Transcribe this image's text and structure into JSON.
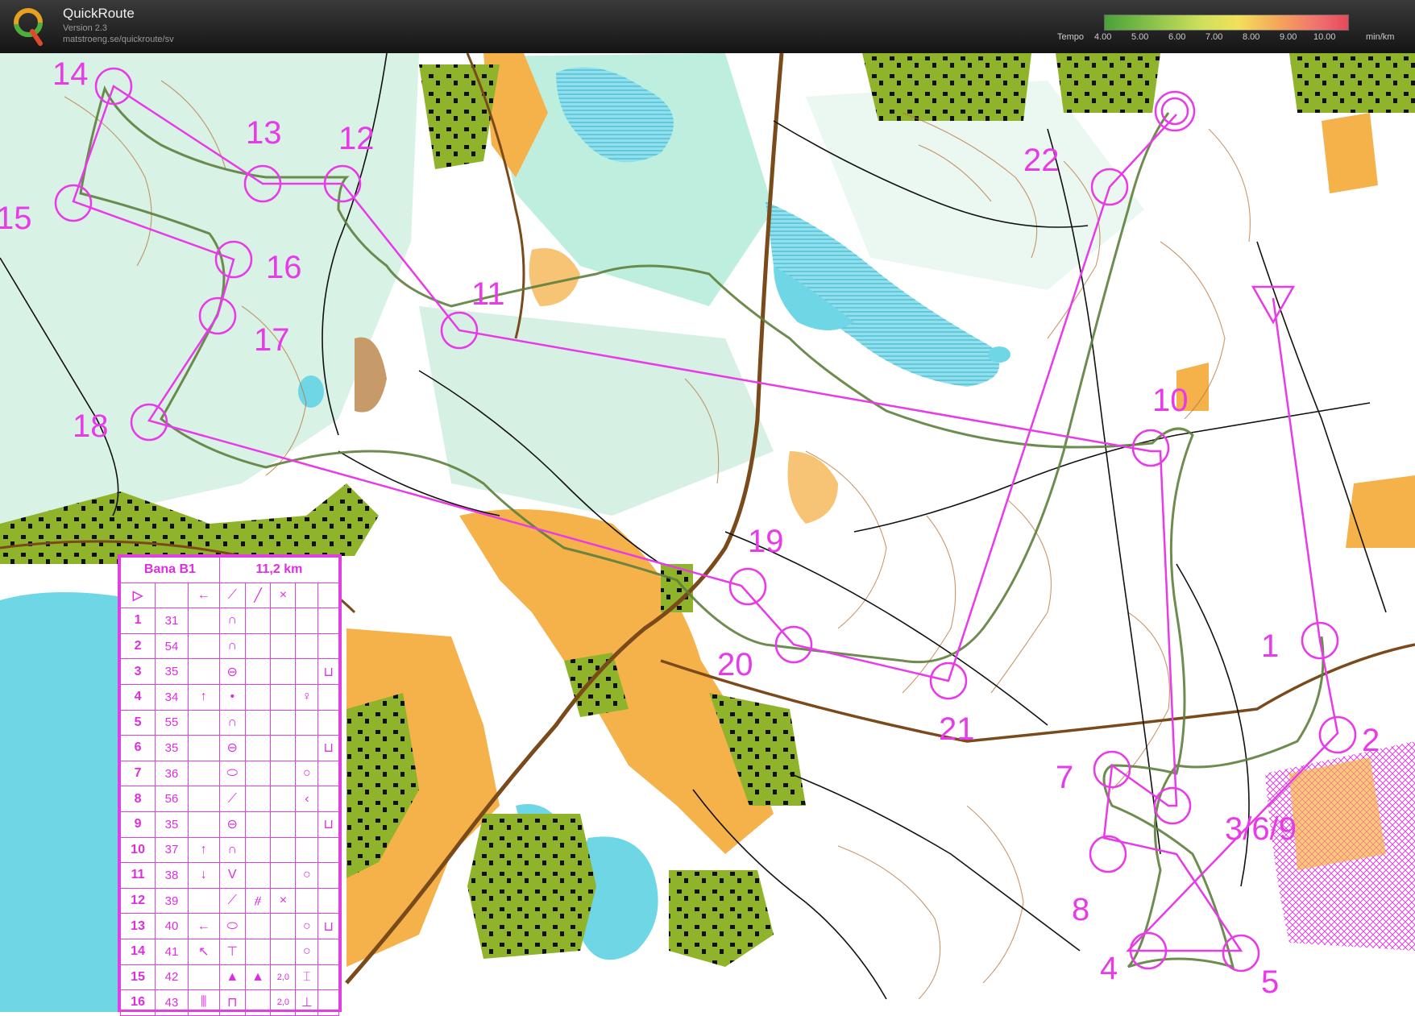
{
  "header": {
    "title": "QuickRoute",
    "version": "Version 2.3",
    "url": "matstroeng.se/quickroute/sv",
    "logo_letter": "Q"
  },
  "tempo_legend": {
    "label": "Tempo",
    "ticks": [
      "4.00",
      "5.00",
      "6.00",
      "7.00",
      "8.00",
      "9.00",
      "10.00"
    ],
    "unit": "min/km"
  },
  "colors": {
    "course": "#e83ae8",
    "route": "#5e7f3c",
    "water": "#6fd6e6",
    "open": "#f5b14a",
    "green": "#8fb32a",
    "forest": "#ffffff"
  },
  "controls": [
    {
      "label": "1"
    },
    {
      "label": "2"
    },
    {
      "label": "3/6/9"
    },
    {
      "label": "4"
    },
    {
      "label": "5"
    },
    {
      "label": "7"
    },
    {
      "label": "8"
    },
    {
      "label": "10"
    },
    {
      "label": "11"
    },
    {
      "label": "12"
    },
    {
      "label": "13"
    },
    {
      "label": "14"
    },
    {
      "label": "15"
    },
    {
      "label": "16"
    },
    {
      "label": "17"
    },
    {
      "label": "18"
    },
    {
      "label": "19"
    },
    {
      "label": "20"
    },
    {
      "label": "21"
    },
    {
      "label": "22"
    }
  ],
  "control_card": {
    "course_name": "Bana B1",
    "length": "11,2 km",
    "start_row": [
      "▷",
      "",
      "←",
      "⟋",
      "╱",
      "×",
      "",
      ""
    ],
    "rows": [
      [
        "1",
        "31",
        "",
        "∩",
        "",
        "",
        "",
        ""
      ],
      [
        "2",
        "54",
        "",
        "∩",
        "",
        "",
        "",
        ""
      ],
      [
        "3",
        "35",
        "",
        "⊖",
        "",
        "",
        "",
        "⊔"
      ],
      [
        "4",
        "34",
        "↑",
        "•",
        "",
        "",
        "♀",
        ""
      ],
      [
        "5",
        "55",
        "",
        "∩",
        "",
        "",
        "",
        ""
      ],
      [
        "6",
        "35",
        "",
        "⊖",
        "",
        "",
        "",
        "⊔"
      ],
      [
        "7",
        "36",
        "",
        "⬭",
        "",
        "",
        "○",
        ""
      ],
      [
        "8",
        "56",
        "",
        "⟋",
        "",
        "",
        "‹",
        ""
      ],
      [
        "9",
        "35",
        "",
        "⊖",
        "",
        "",
        "",
        "⊔"
      ],
      [
        "10",
        "37",
        "↑",
        "∩",
        "",
        "",
        "",
        ""
      ],
      [
        "11",
        "38",
        "↓",
        "V",
        "",
        "",
        "○",
        ""
      ],
      [
        "12",
        "39",
        "",
        "⟋",
        "⧣",
        "×",
        "",
        ""
      ],
      [
        "13",
        "40",
        "←",
        "⬭",
        "",
        "",
        "○",
        "⊔"
      ],
      [
        "14",
        "41",
        "↖",
        "⊤",
        "",
        "",
        "○",
        ""
      ],
      [
        "15",
        "42",
        "",
        "▲",
        "▲",
        "2,0",
        "⌶",
        ""
      ],
      [
        "16",
        "43",
        "⫼",
        "⊓",
        "",
        "2,0",
        "⊥",
        ""
      ]
    ]
  }
}
